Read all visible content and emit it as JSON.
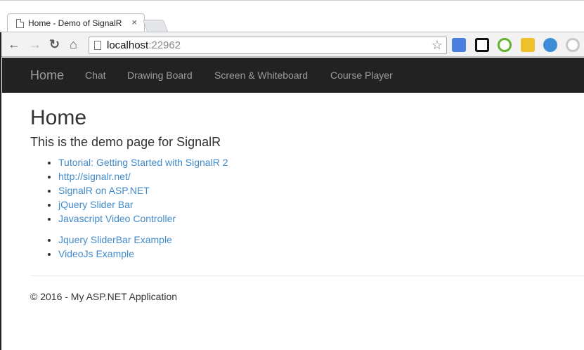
{
  "browser": {
    "tab_title": "Home - Demo of SignalR",
    "tab_close": "×",
    "url_host": "localhost",
    "url_port": ":22962",
    "nav_back": "←",
    "nav_forward": "→",
    "nav_reload": "↻",
    "nav_home": "⌂",
    "star": "☆",
    "extensions": [
      "google-translate-icon",
      "qr-code-icon",
      "green-swirl-icon",
      "checkmark-badge-icon",
      "globe-icon",
      "gray-swirl-icon"
    ]
  },
  "site": {
    "brand": "Home",
    "nav": [
      "Chat",
      "Drawing Board",
      "Screen & Whiteboard",
      "Course Player"
    ]
  },
  "main": {
    "title": "Home",
    "subtitle": "This is the demo page for SignalR",
    "links_1": [
      "Tutorial: Getting Started with SignalR 2",
      "http://signalr.net/",
      "SignalR on ASP.NET",
      "jQuery Slider Bar",
      "Javascript Video Controller"
    ],
    "links_2": [
      "Jquery SliderBar Example",
      "VideoJs Example"
    ]
  },
  "footer": {
    "text": "© 2016 - My ASP.NET Application"
  },
  "colors": {
    "nav_bg": "#222222",
    "link": "#428bca",
    "nav_text": "#9d9d9d"
  }
}
